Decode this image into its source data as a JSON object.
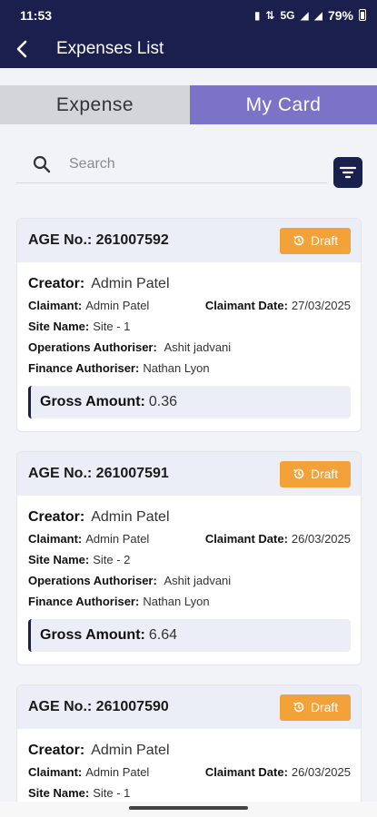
{
  "status_bar": {
    "time": "11:53",
    "network_text": "5G",
    "battery": "79%"
  },
  "app_bar": {
    "title": "Expenses List",
    "back_icon": "chevron-left-icon"
  },
  "tabs": [
    {
      "label": "Expense",
      "selected": false
    },
    {
      "label": "My Card",
      "selected": true
    }
  ],
  "search": {
    "placeholder": "Search",
    "value": ""
  },
  "colors": {
    "primary": "#1b1f4d",
    "tab_active": "#7a73c8",
    "draft": "#f3a23a"
  },
  "cards": [
    {
      "age_label": "AGE No.:",
      "age_no": "261007592",
      "status": "Draft",
      "creator_label": "Creator:",
      "creator": "Admin Patel",
      "claimant_label": "Claimant:",
      "claimant": "Admin Patel",
      "claimant_date_label": "Claimant Date:",
      "claimant_date": "27/03/2025",
      "site_label": "Site Name:",
      "site": "Site - 1",
      "ops_label": "Operations Authoriser:",
      "ops": "Ashit jadvani",
      "fin_label": "Finance Authoriser:",
      "fin": "Nathan Lyon",
      "gross_label": "Gross Amount:",
      "gross": "0.36"
    },
    {
      "age_label": "AGE No.:",
      "age_no": "261007591",
      "status": "Draft",
      "creator_label": "Creator:",
      "creator": "Admin Patel",
      "claimant_label": "Claimant:",
      "claimant": "Admin Patel",
      "claimant_date_label": "Claimant Date:",
      "claimant_date": "26/03/2025",
      "site_label": "Site Name:",
      "site": "Site - 2",
      "ops_label": "Operations Authoriser:",
      "ops": "Ashit jadvani",
      "fin_label": "Finance Authoriser:",
      "fin": "Nathan Lyon",
      "gross_label": "Gross Amount:",
      "gross": "6.64"
    },
    {
      "age_label": "AGE No.:",
      "age_no": "261007590",
      "status": "Draft",
      "creator_label": "Creator:",
      "creator": "Admin Patel",
      "claimant_label": "Claimant:",
      "claimant": "Admin Patel",
      "claimant_date_label": "Claimant Date:",
      "claimant_date": "26/03/2025",
      "site_label": "Site Name:",
      "site": "Site - 1"
    }
  ]
}
